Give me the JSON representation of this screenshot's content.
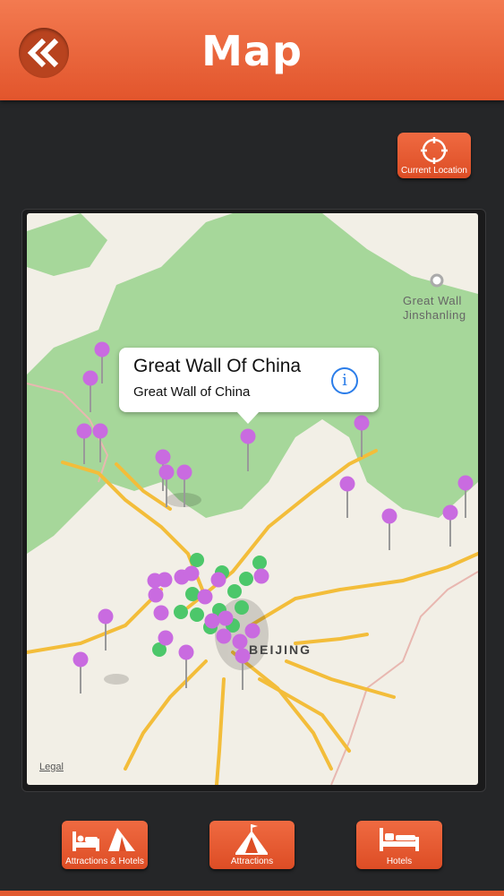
{
  "header": {
    "title": "Map",
    "back_icon": "double-chevron-left-icon"
  },
  "location_button": {
    "label": "Current Location",
    "icon": "crosshair-icon"
  },
  "map": {
    "callout": {
      "title": "Great Wall Of China",
      "subtitle": "Great Wall of China",
      "icon": "info-icon"
    },
    "labels": {
      "great_wall_jinshanling_1": "Great Wall",
      "great_wall_jinshanling_2": "Jinshanling",
      "city": "BEIJING"
    },
    "legal": "Legal",
    "colors": {
      "attraction_pin": "#c96be0",
      "hotel_pin": "#4cc76a",
      "road": "#f3bd3a",
      "park": "#a6d79a"
    }
  },
  "tabs": [
    {
      "label": "Attractions & Hotels",
      "icon": "bed-and-tent-icon"
    },
    {
      "label": "Attractions",
      "icon": "tent-icon"
    },
    {
      "label": "Hotels",
      "icon": "bed-icon"
    }
  ]
}
